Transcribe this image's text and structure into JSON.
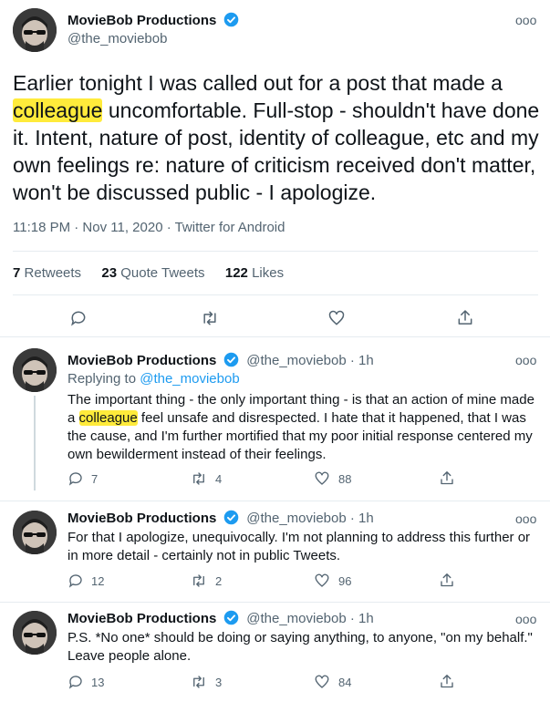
{
  "main": {
    "author_name": "MovieBob Productions",
    "author_handle": "@the_moviebob",
    "more": "ooo",
    "text_before": "Earlier tonight I was called out for a post that made a ",
    "text_highlight": "colleague",
    "text_after": " uncomfortable. Full-stop - shouldn't have done it. Intent, nature of post, identity of colleague, etc and my own feelings re: nature of criticism received don't matter, won't be discussed public - I apologize.",
    "timestamp": "11:18 PM · Nov 11, 2020 · Twitter for Android",
    "stats": {
      "retweets_count": "7",
      "retweets_label": "Retweets",
      "quotes_count": "23",
      "quotes_label": "Quote Tweets",
      "likes_count": "122",
      "likes_label": "Likes"
    }
  },
  "replies": [
    {
      "author_name": "MovieBob Productions",
      "handle_time": "@the_moviebob · 1h",
      "replying_prefix": "Replying to ",
      "replying_handle": "@the_moviebob",
      "text_before": "The important thing - the only important thing - is that an action of mine made a ",
      "text_highlight": "colleague",
      "text_after": " feel unsafe and disrespected. I hate that it happened, that I was the cause, and I'm further mortified that my poor initial response centered my own bewilderment instead of their feelings.",
      "reply_count": "7",
      "retweet_count": "4",
      "like_count": "88"
    },
    {
      "author_name": "MovieBob Productions",
      "handle_time": "@the_moviebob · 1h",
      "text": "For that I apologize, unequivocally. I'm not planning to address this further or in more detail - certainly not in public Tweets.",
      "reply_count": "12",
      "retweet_count": "2",
      "like_count": "96"
    },
    {
      "author_name": "MovieBob Productions",
      "handle_time": "@the_moviebob · 1h",
      "text": "P.S. *No one* should be doing or saying anything, to anyone, \"on my behalf.\" Leave people alone.",
      "reply_count": "13",
      "retweet_count": "3",
      "like_count": "84"
    }
  ],
  "icons": {
    "reply": "reply-icon",
    "retweet": "retweet-icon",
    "like": "heart-icon",
    "share": "share-icon",
    "verified": "verified-badge-icon",
    "more": "more-options-icon"
  },
  "colors": {
    "accent": "#1d9bf0",
    "highlight": "#ffeb3b",
    "secondary_text": "#536471"
  }
}
